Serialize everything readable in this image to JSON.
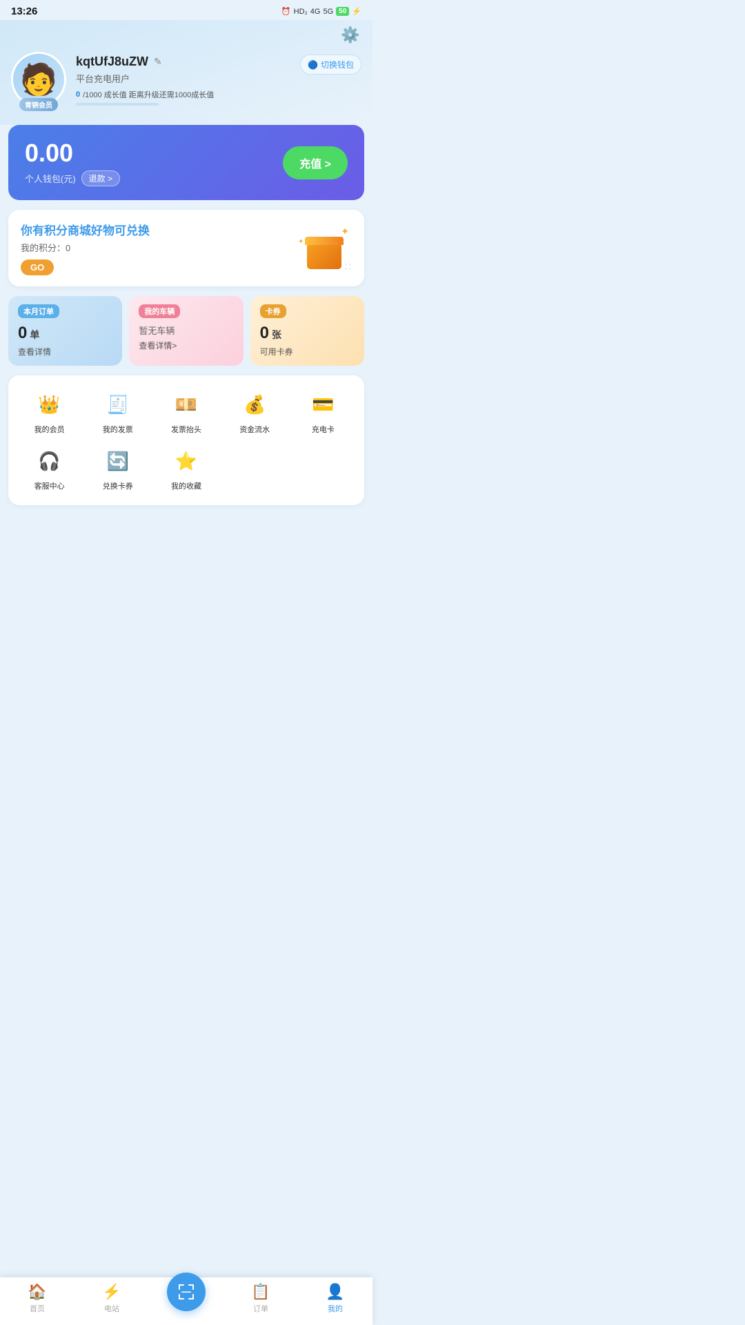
{
  "status": {
    "time": "13:26",
    "battery": "50"
  },
  "header": {
    "settings_label": "⚙",
    "username": "kqtUfJ8uZW",
    "edit_icon": "✎",
    "user_type": "平台充电用户",
    "growth_current": "0",
    "growth_total": "1000",
    "growth_text": "成长值 距离升级还需1000成长值",
    "switch_wallet_label": "切换钱包",
    "member_badge": "青铜会员"
  },
  "wallet": {
    "amount": "0.00",
    "label": "个人钱包(元)",
    "refund_label": "退款 >",
    "topup_label": "充值 >"
  },
  "points": {
    "title_prefix": "你有积分商城好物",
    "title_highlight": "可兑换",
    "score_label": "我的积分：",
    "score_value": "0",
    "go_label": "GO"
  },
  "stats": {
    "monthly_orders": {
      "label": "本月订单",
      "value": "0",
      "unit": "单",
      "detail": "查看详情"
    },
    "vehicles": {
      "label": "我的车辆",
      "empty": "暂无车辆",
      "detail": "查看详情>"
    },
    "coupons": {
      "label": "卡券",
      "value": "0",
      "unit": "张",
      "desc": "可用卡券"
    }
  },
  "menu": {
    "items": [
      {
        "icon": "👑",
        "label": "我的会员",
        "name": "member"
      },
      {
        "icon": "🧾",
        "label": "我的发票",
        "name": "invoice"
      },
      {
        "icon": "💴",
        "label": "发票抬头",
        "name": "invoice-header"
      },
      {
        "icon": "💰",
        "label": "资金流水",
        "name": "fund-flow"
      },
      {
        "icon": "💳",
        "label": "充电卡",
        "name": "charge-card"
      },
      {
        "icon": "🎧",
        "label": "客服中心",
        "name": "customer-service"
      },
      {
        "icon": "🔄",
        "label": "兑换卡券",
        "name": "exchange-coupon"
      },
      {
        "icon": "⭐",
        "label": "我的收藏",
        "name": "my-favorites"
      }
    ]
  },
  "bottom_nav": {
    "items": [
      {
        "label": "首页",
        "icon": "🏠",
        "active": false
      },
      {
        "label": "电站",
        "icon": "⚡",
        "active": false
      },
      {
        "label": "",
        "icon": "scan",
        "active": false,
        "center": true
      },
      {
        "label": "订单",
        "icon": "📋",
        "active": false
      },
      {
        "label": "我的",
        "icon": "👤",
        "active": true
      }
    ]
  }
}
